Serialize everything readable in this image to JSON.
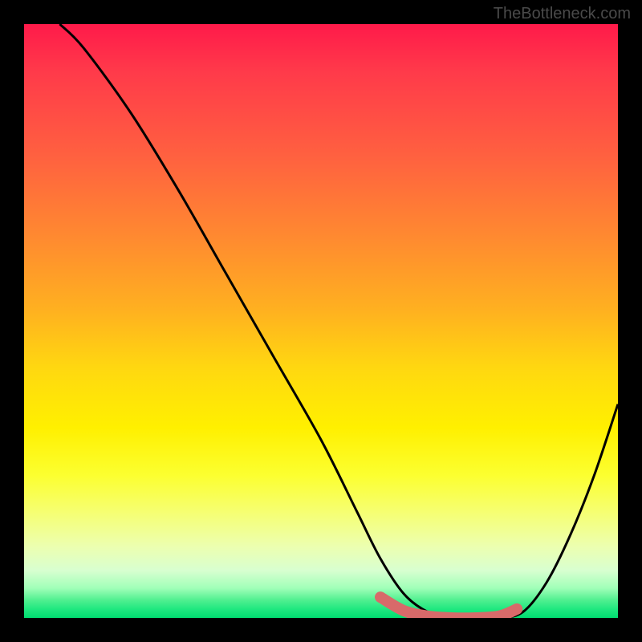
{
  "watermark": "TheBottleneck.com",
  "chart_data": {
    "type": "line",
    "title": "",
    "xlabel": "",
    "ylabel": "",
    "xlim": [
      0,
      100
    ],
    "ylim": [
      0,
      100
    ],
    "series": [
      {
        "name": "bottleneck-curve",
        "x": [
          6,
          10,
          18,
          26,
          34,
          42,
          50,
          56,
          60,
          64,
          68,
          72,
          76,
          80,
          84,
          88,
          92,
          96,
          100
        ],
        "values": [
          100,
          96,
          85,
          72,
          58,
          44,
          30,
          18,
          10,
          4,
          1,
          0,
          0,
          0,
          1,
          6,
          14,
          24,
          36
        ]
      },
      {
        "name": "optimal-range-marker",
        "x": [
          60,
          64,
          68,
          72,
          76,
          80,
          83
        ],
        "values": [
          3.5,
          1.2,
          0.3,
          0,
          0,
          0.3,
          1.5
        ]
      }
    ],
    "gradient_stops": [
      {
        "pos": 0,
        "color": "#ff1a4a"
      },
      {
        "pos": 50,
        "color": "#ffd000"
      },
      {
        "pos": 100,
        "color": "#00dd70"
      }
    ]
  }
}
